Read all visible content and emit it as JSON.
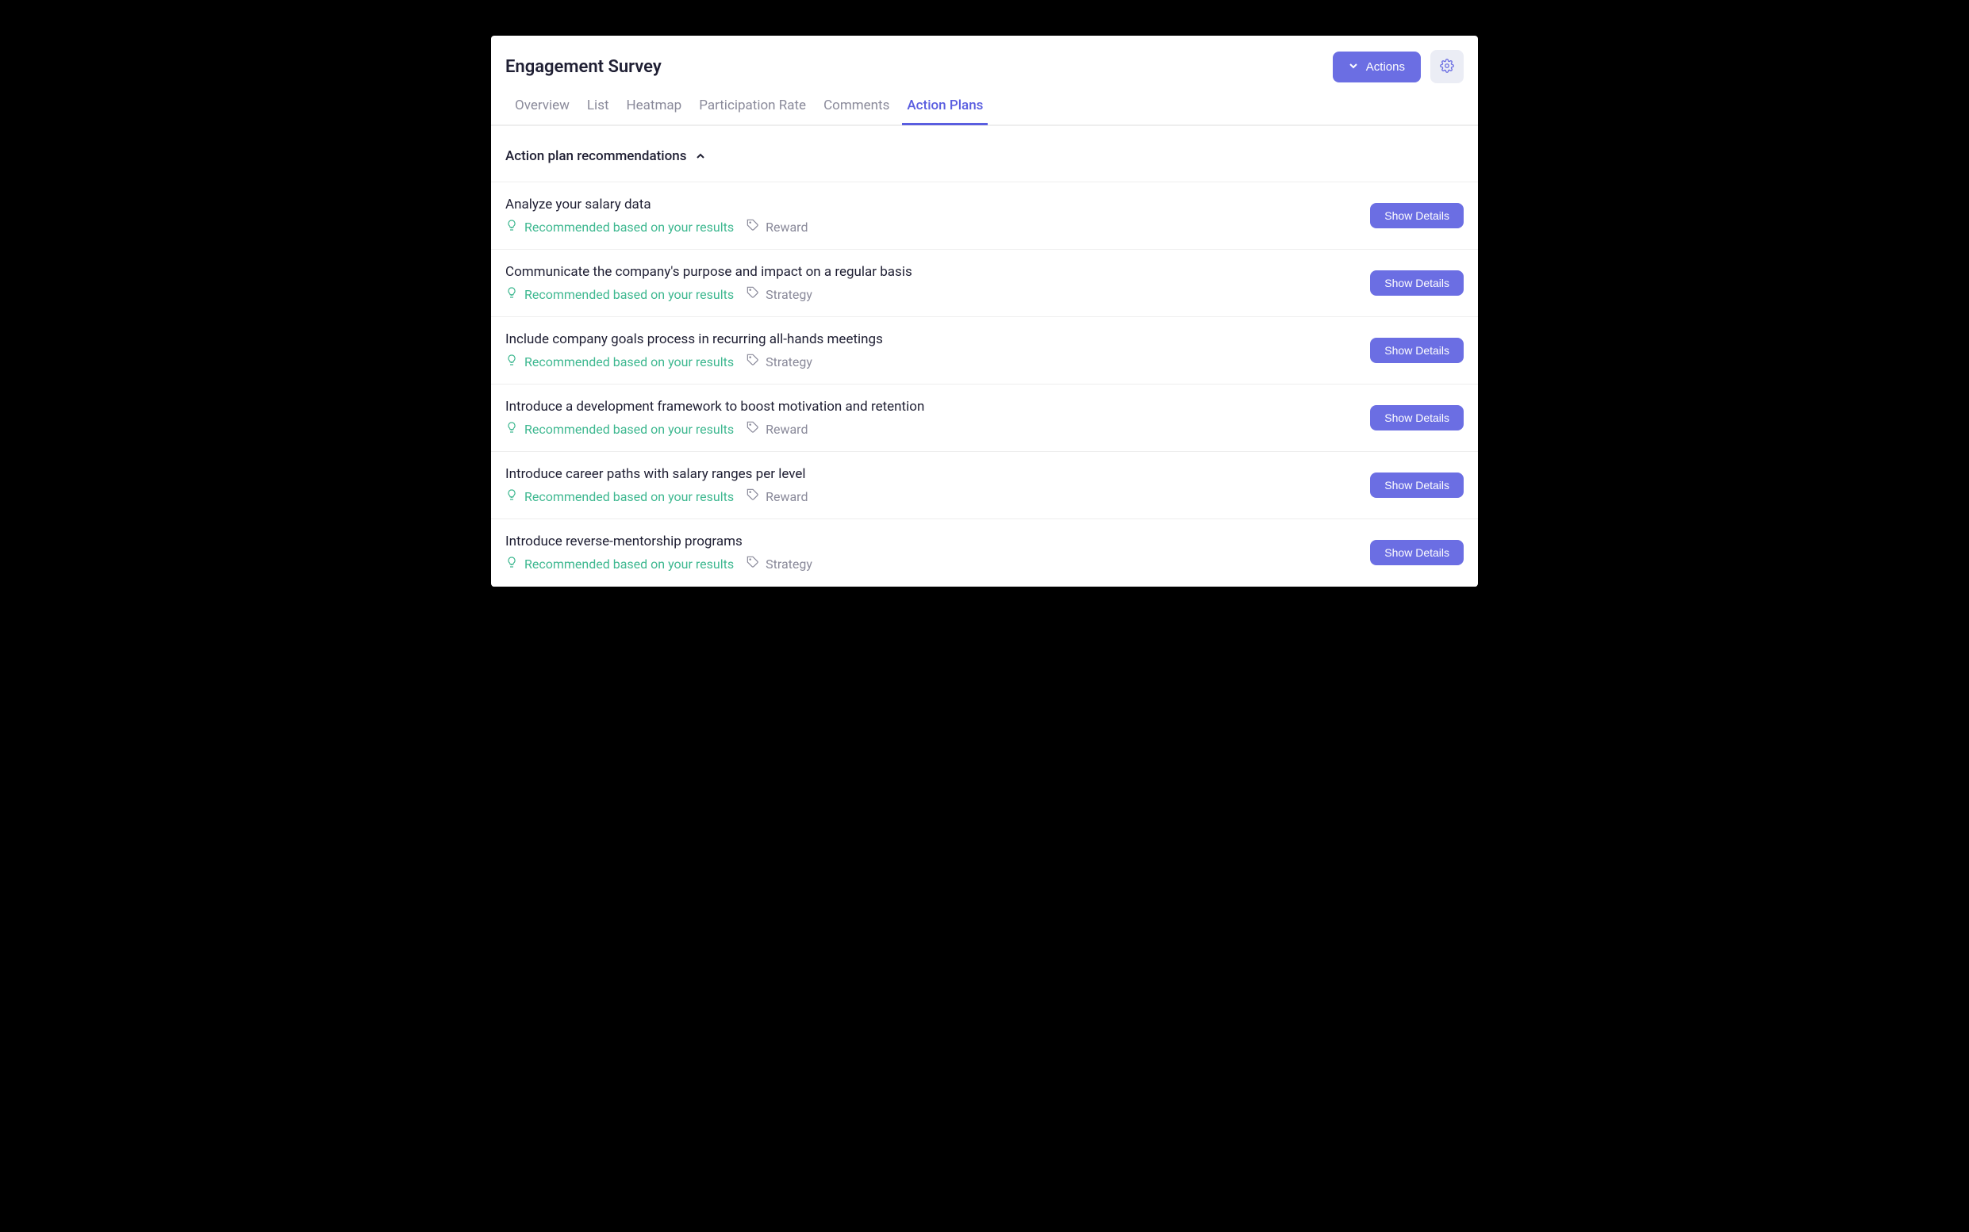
{
  "header": {
    "title": "Engagement Survey",
    "actions_label": "Actions"
  },
  "tabs": [
    {
      "label": "Overview",
      "active": false
    },
    {
      "label": "List",
      "active": false
    },
    {
      "label": "Heatmap",
      "active": false
    },
    {
      "label": "Participation Rate",
      "active": false
    },
    {
      "label": "Comments",
      "active": false
    },
    {
      "label": "Action Plans",
      "active": true
    }
  ],
  "section": {
    "title": "Action plan recommendations"
  },
  "common": {
    "reason_text": "Recommended based on your results",
    "show_details_label": "Show Details"
  },
  "recommendations": [
    {
      "title": "Analyze your salary data",
      "category": "Reward"
    },
    {
      "title": "Communicate the company's purpose and impact on a regular basis",
      "category": "Strategy"
    },
    {
      "title": "Include company goals process in recurring all-hands meetings",
      "category": "Strategy"
    },
    {
      "title": "Introduce a development framework to boost motivation and retention",
      "category": "Reward"
    },
    {
      "title": "Introduce career paths with salary ranges per level",
      "category": "Reward"
    },
    {
      "title": "Introduce reverse-mentorship programs",
      "category": "Strategy"
    }
  ]
}
